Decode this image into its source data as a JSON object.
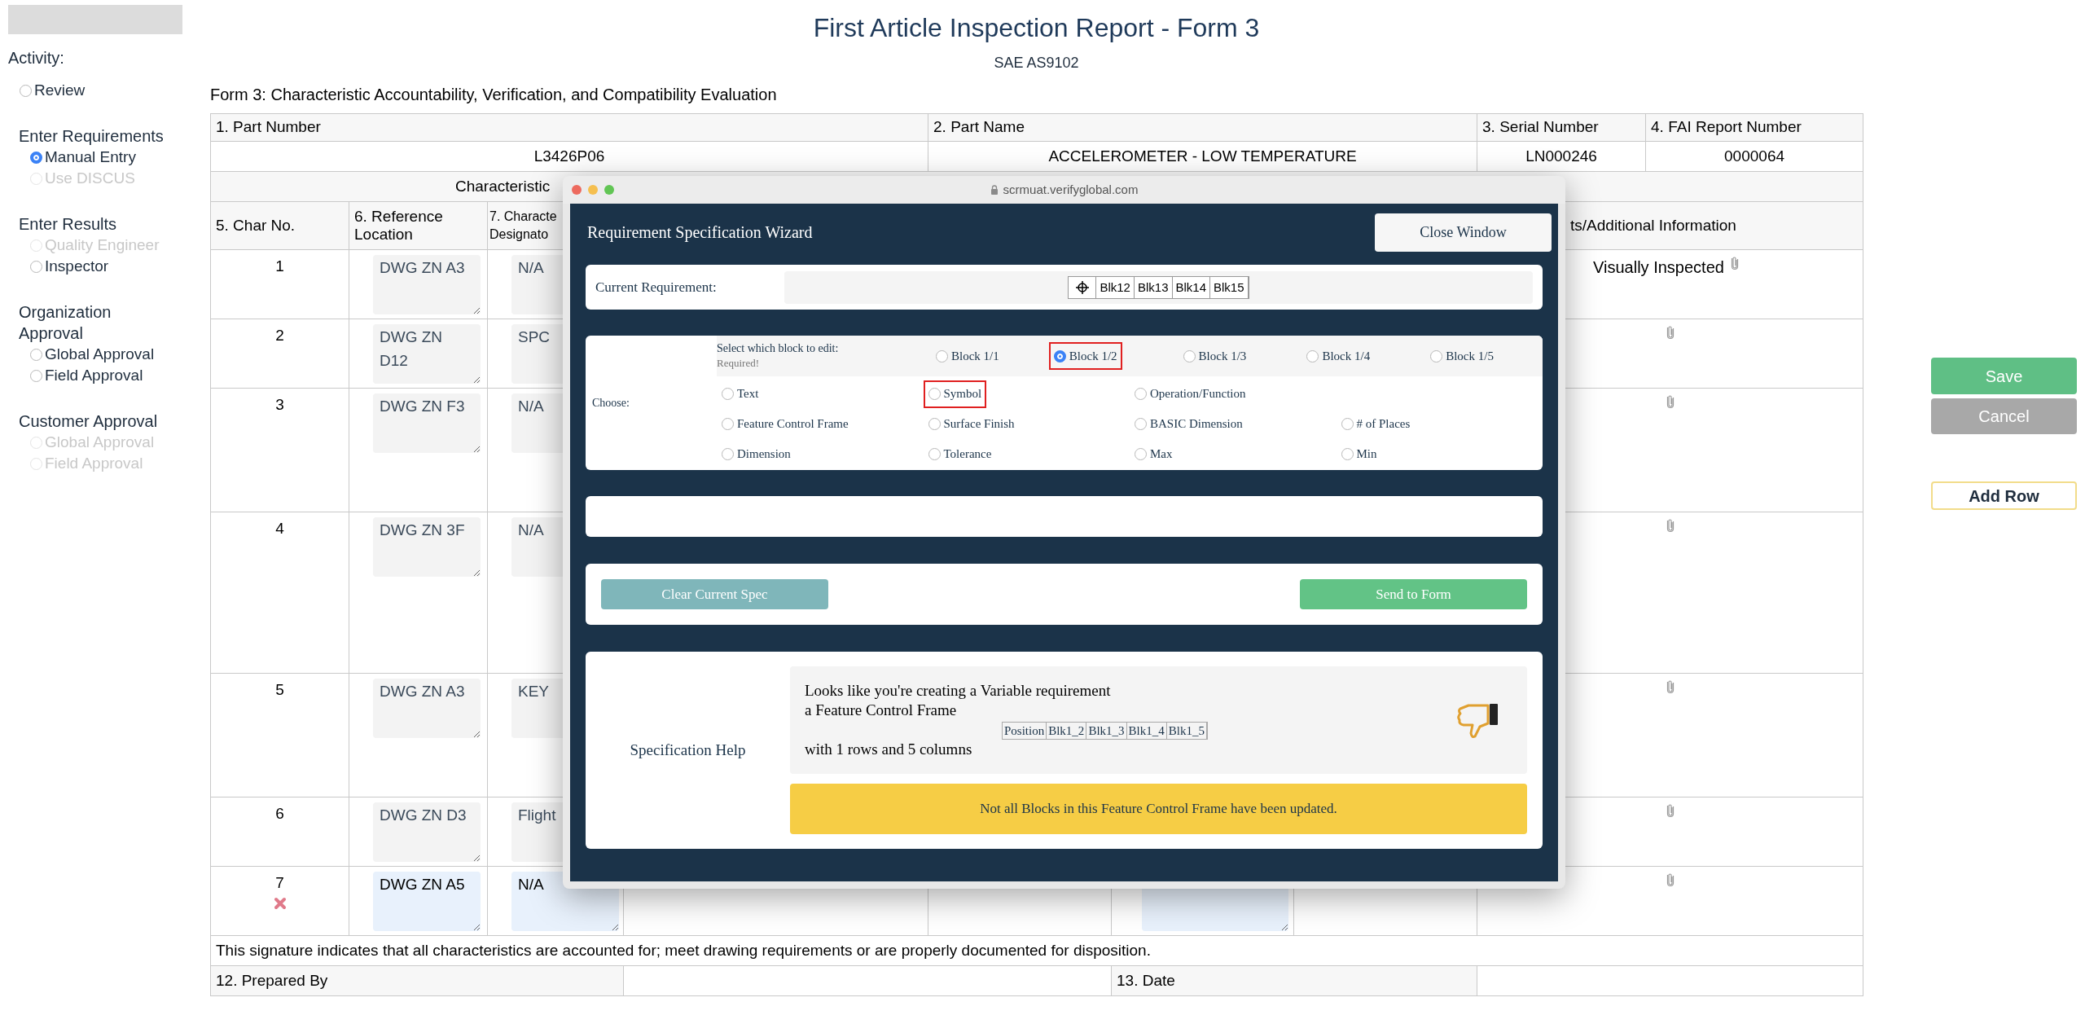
{
  "sidebar": {
    "activity_label": "Activity:",
    "activity_options": [
      {
        "label": "Review",
        "selected": false,
        "disabled": false
      }
    ],
    "groups": [
      {
        "title": "Enter Requirements",
        "options": [
          {
            "label": "Manual Entry",
            "selected": true,
            "disabled": false
          },
          {
            "label": "Use DISCUS",
            "selected": false,
            "disabled": true
          }
        ]
      },
      {
        "title": "Enter Results",
        "options": [
          {
            "label": "Quality Engineer",
            "selected": false,
            "disabled": true
          },
          {
            "label": "Inspector",
            "selected": false,
            "disabled": false
          }
        ]
      },
      {
        "title": "Organization Approval",
        "options": [
          {
            "label": "Global Approval",
            "selected": false,
            "disabled": false
          },
          {
            "label": "Field Approval",
            "selected": false,
            "disabled": false
          }
        ]
      },
      {
        "title": "Customer Approval",
        "options": [
          {
            "label": "Global Approval",
            "selected": false,
            "disabled": true
          },
          {
            "label": "Field Approval",
            "selected": false,
            "disabled": true
          }
        ]
      }
    ]
  },
  "header": {
    "title": "First Article Inspection Report - Form 3",
    "subtitle": "SAE AS9102",
    "caption": "Form 3: Characteristic Accountability, Verification, and Compatibility Evaluation"
  },
  "table": {
    "part_headers": [
      "1. Part Number",
      "2. Part Name",
      "3. Serial Number",
      "4. FAI Report Number"
    ],
    "part_values": [
      "L3426P06",
      "ACCELEROMETER - LOW TEMPERATURE",
      "LN000246",
      "0000064"
    ],
    "section_label": "Characteristic",
    "columns": [
      "5. Char No.",
      "6. Reference Location",
      "7. Characte\nDesignato",
      "ts/Additional Information"
    ],
    "rows": [
      {
        "char_no": "1",
        "reference": "DWG ZN A3",
        "designator": "N/A",
        "comment": "Visually Inspected",
        "new": false
      },
      {
        "char_no": "2",
        "reference": "DWG ZN D12",
        "designator": "SPC",
        "new": false
      },
      {
        "char_no": "3",
        "reference": "DWG ZN F3",
        "designator": "N/A",
        "new": false
      },
      {
        "char_no": "4",
        "reference": "DWG ZN 3F",
        "designator": "N/A",
        "new": false
      },
      {
        "char_no": "5",
        "reference": "DWG ZN A3",
        "designator": "KEY",
        "new": false
      },
      {
        "char_no": "6",
        "reference": "DWG ZN D3",
        "designator": "Flight",
        "new": false
      },
      {
        "char_no": "7",
        "reference": "DWG ZN A5",
        "designator": "N/A",
        "new": true
      }
    ],
    "signature_note": "This signature indicates that all characteristics are accounted for; meet drawing requirements or are properly documented for disposition.",
    "signature_fields": [
      "12. Prepared By",
      "13. Date"
    ]
  },
  "actions": [
    {
      "label": "Save",
      "kind": "save"
    },
    {
      "label": "Cancel",
      "kind": "cancel"
    },
    {
      "label": "Add Row",
      "kind": "add"
    }
  ],
  "wizard": {
    "url": "scrmuat.verifyglobal.com",
    "title": "Requirement Specification Wizard",
    "close_button": "Close Window",
    "current_label": "Current Requirement:",
    "current_frame": [
      "Blk12",
      "Blk13",
      "Blk14",
      "Blk15"
    ],
    "choose_label": "Choose:",
    "block_label": "Select which block to edit:",
    "block_hint": "Required!",
    "blocks": [
      {
        "label": "Block 1/1",
        "selected": false,
        "highlighted": false
      },
      {
        "label": "Block 1/2",
        "selected": true,
        "highlighted": true
      },
      {
        "label": "Block 1/3",
        "selected": false,
        "highlighted": false
      },
      {
        "label": "Block 1/4",
        "selected": false,
        "highlighted": false
      },
      {
        "label": "Block 1/5",
        "selected": false,
        "highlighted": false
      }
    ],
    "option_rows": [
      [
        {
          "label": "Text",
          "selected": false,
          "highlighted": false
        },
        {
          "label": "Symbol",
          "selected": false,
          "highlighted": true
        },
        {
          "label": "Operation/Function",
          "selected": false,
          "highlighted": false
        }
      ],
      [
        {
          "label": "Feature Control Frame",
          "selected": false,
          "highlighted": false
        },
        {
          "label": "Surface Finish",
          "selected": false,
          "highlighted": false
        },
        {
          "label": "BASIC Dimension",
          "selected": false,
          "highlighted": false
        },
        {
          "label": "# of Places",
          "selected": false,
          "highlighted": false
        }
      ],
      [
        {
          "label": "Dimension",
          "selected": false,
          "highlighted": false
        },
        {
          "label": "Tolerance",
          "selected": false,
          "highlighted": false
        },
        {
          "label": "Max",
          "selected": false,
          "highlighted": false
        },
        {
          "label": "Min",
          "selected": false,
          "highlighted": false
        }
      ]
    ],
    "buttons": [
      {
        "label": "Clear Current Spec",
        "kind": "clear"
      },
      {
        "label": "Send to Form",
        "kind": "send"
      }
    ],
    "help_label": "Specification Help",
    "help_lines": [
      "Looks like you're creating a Variable requirement",
      "a Feature Control Frame"
    ],
    "help_frame": [
      "Position",
      "Blk1_2",
      "Blk1_3",
      "Blk1_4",
      "Blk1_5"
    ],
    "help_summary": "with 1 rows and 5 columns",
    "warning": "Not all Blocks in this Feature Control Frame have been updated."
  }
}
